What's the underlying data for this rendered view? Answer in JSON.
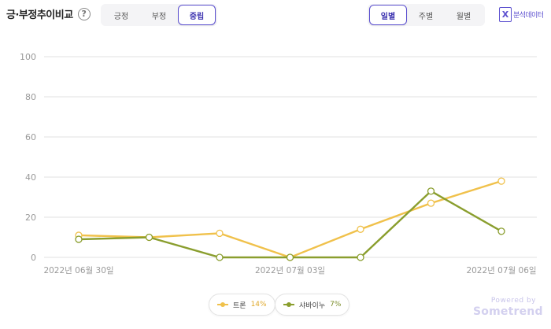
{
  "header": {
    "title": "긍·부정추이비교",
    "help_glyph": "?",
    "sentiment_tabs": [
      "긍정",
      "부정",
      "중립"
    ],
    "sentiment_active": 2,
    "period_tabs": [
      "일별",
      "주별",
      "월별"
    ],
    "period_active": 0,
    "export_icon": "excel-icon",
    "export_glyph": "X",
    "export_label": "분석데이터"
  },
  "branding": {
    "powered_by": "Powered by",
    "name": "Sometrend"
  },
  "colors": {
    "accent": "#5b4fcf",
    "series_0": "#f0c14b",
    "series_1": "#8a9e2e",
    "grid": "#e2e2e2"
  },
  "chart_data": {
    "type": "line",
    "x": [
      "2022-06-30",
      "2022-07-01",
      "2022-07-02",
      "2022-07-03",
      "2022-07-04",
      "2022-07-05",
      "2022-07-06"
    ],
    "x_tick_labels": [
      "2022년 06월 30일",
      "",
      "",
      "2022년 07월 03일",
      "",
      "",
      "2022년 07월 06일"
    ],
    "ylim": [
      0,
      100
    ],
    "yticks": [
      0,
      20,
      40,
      60,
      80,
      100
    ],
    "grid": true,
    "legend_position": "bottom-center",
    "series": [
      {
        "name": "트론",
        "share": "14%",
        "color": "#f0c14b",
        "values": [
          11,
          10,
          12,
          0,
          14,
          27,
          38
        ]
      },
      {
        "name": "샤바이누",
        "share": "7%",
        "color": "#8a9e2e",
        "values": [
          9,
          10,
          0,
          0,
          0,
          33,
          13
        ]
      }
    ]
  }
}
